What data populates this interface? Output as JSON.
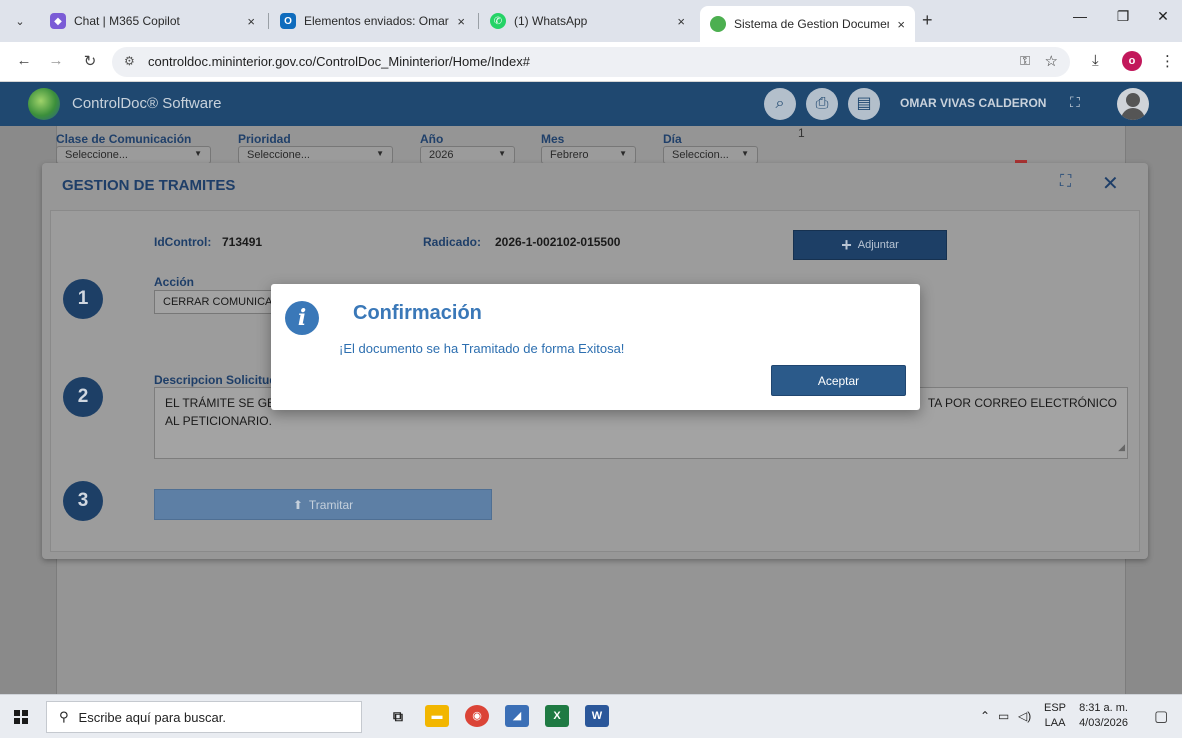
{
  "browser": {
    "tabs": [
      {
        "title": "Chat | M365 Copilot",
        "favicon_color": "#7b5cd6"
      },
      {
        "title": "Elementos enviados: Omar Viva",
        "favicon_color": "#0f6cbd"
      },
      {
        "title": "(1) WhatsApp",
        "favicon_color": "#25d366"
      },
      {
        "title": "Sistema de Gestion Documenta",
        "favicon_color": "#4caf50"
      }
    ],
    "close_glyph": "×",
    "new_tab_glyph": "+",
    "url": "controldoc.mininterior.gov.co/ControlDoc_Mininterior/Home/Index#",
    "profile_initial": "o"
  },
  "app": {
    "name": "ControlDoc® Software",
    "user": "OMAR VIVAS CALDERON"
  },
  "filters": {
    "clase": {
      "label": "Clase de Comunicación",
      "value": "Seleccione..."
    },
    "prioridad": {
      "label": "Prioridad",
      "value": "Seleccione..."
    },
    "anio": {
      "label": "Año",
      "value": "2026"
    },
    "mes": {
      "label": "Mes",
      "value": "Febrero"
    },
    "dia": {
      "label": "Día",
      "value": "Seleccion..."
    },
    "count": "1"
  },
  "modal": {
    "title": "GESTION DE TRAMITES",
    "idcontrol_label": "IdControl:",
    "idcontrol_value": "713491",
    "radicado_label": "Radicado:",
    "radicado_value": "2026-1-002102-015500",
    "adjuntar_label": "Adjuntar",
    "step1": "1",
    "step2": "2",
    "step3": "3",
    "accion_label": "Acción",
    "accion_value": "CERRAR COMUNICACIO",
    "descripcion_label": "Descripcion Solicitud",
    "descripcion_left": "EL TRÁMITE SE GES",
    "descripcion_right": "TA POR CORREO ELECTRÓNICO",
    "descripcion_line2": "AL PETICIONARIO.",
    "tramitar_label": "Tramitar"
  },
  "confirm": {
    "icon": "i",
    "title": "Confirmación",
    "message": "¡El documento se ha Tramitado de forma Exitosa!",
    "button": "Aceptar"
  },
  "taskbar": {
    "search_placeholder": "Escribe aquí para buscar.",
    "lang1": "ESP",
    "lang2": "LAA",
    "time": "8:31 a. m.",
    "date": "4/03/2026"
  }
}
